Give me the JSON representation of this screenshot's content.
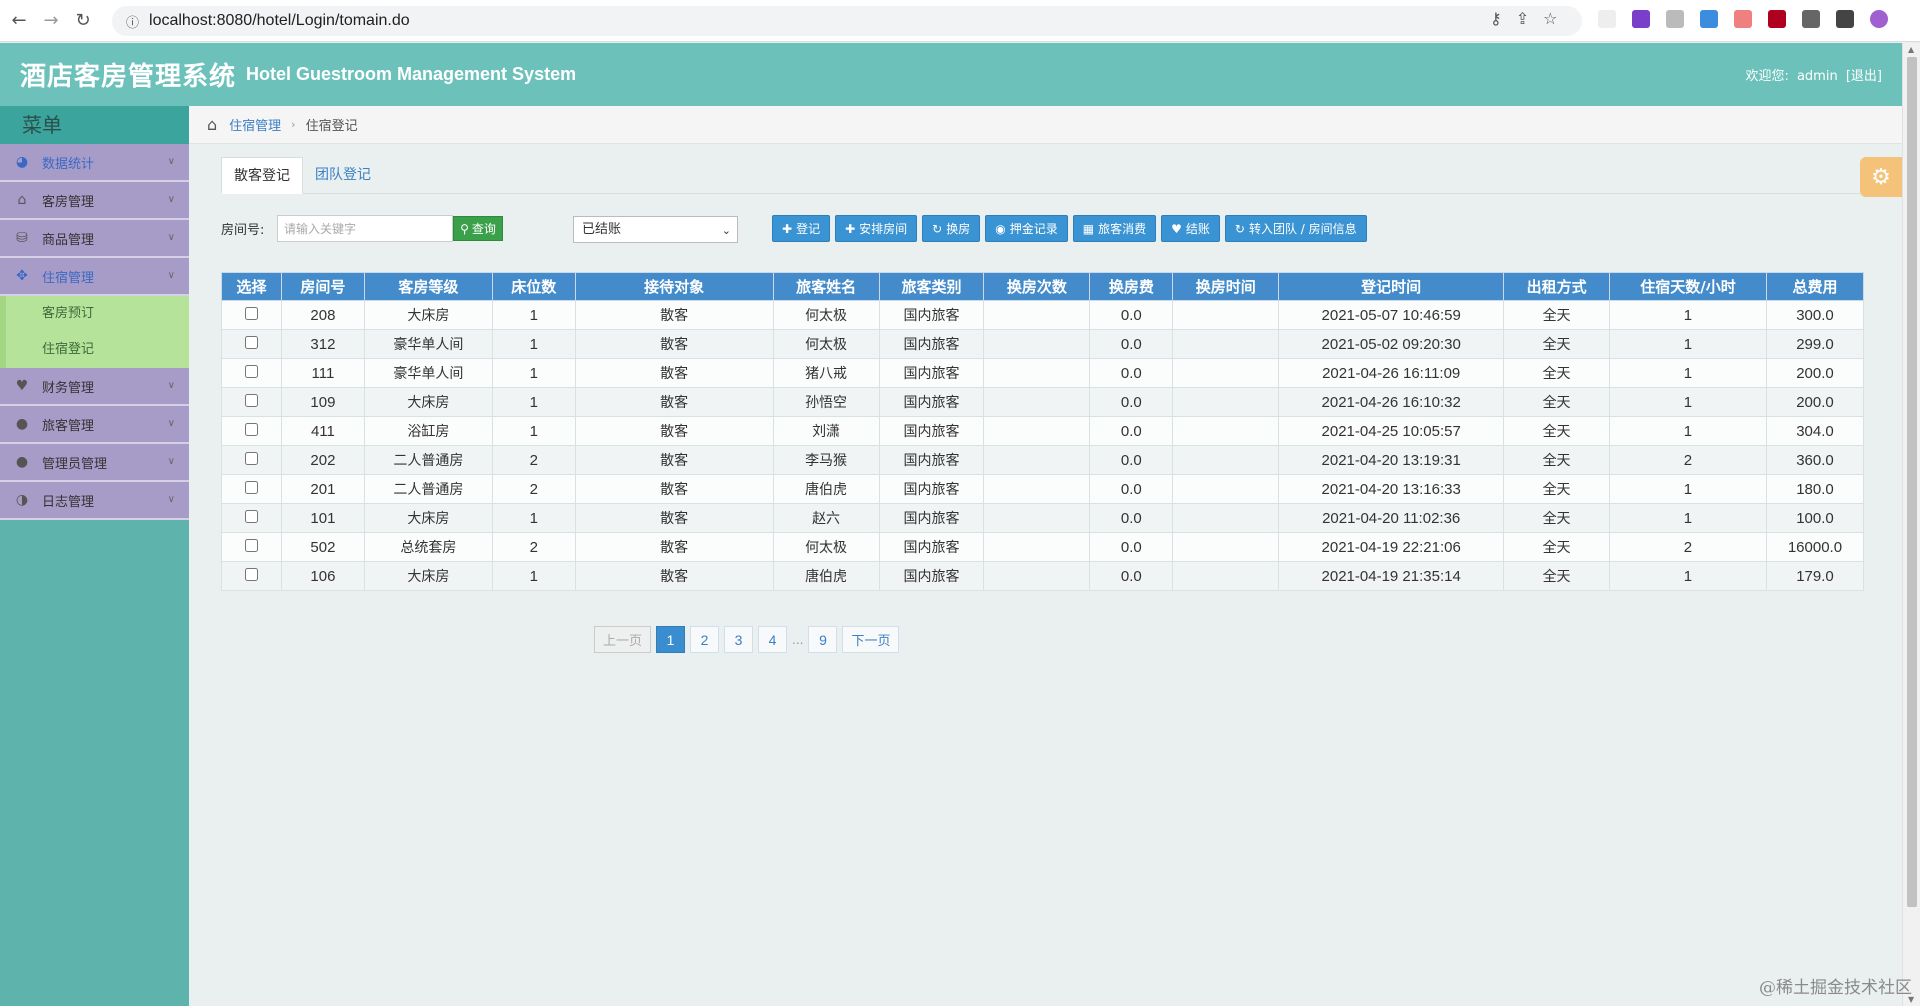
{
  "browser": {
    "url": "localhost:8080/hotel/Login/tomain.do"
  },
  "header": {
    "title": "酒店客房管理系统",
    "subtitle": "Hotel Guestroom Management System",
    "welcome_label": "欢迎您:",
    "username": "admin",
    "logout_label": "[退出]"
  },
  "sidebar": {
    "menu_title": "菜单",
    "items": [
      {
        "label": "数据统计",
        "icon": "dashboard-icon"
      },
      {
        "label": "客房管理",
        "icon": "home-icon"
      },
      {
        "label": "商品管理",
        "icon": "database-icon"
      },
      {
        "label": "住宿管理",
        "icon": "move-icon"
      },
      {
        "label": "财务管理",
        "icon": "heart-icon"
      },
      {
        "label": "旅客管理",
        "icon": "user-icon"
      },
      {
        "label": "管理员管理",
        "icon": "user-icon"
      },
      {
        "label": "日志管理",
        "icon": "contrast-icon"
      }
    ],
    "subitems": [
      {
        "label": "客房预订"
      },
      {
        "label": "住宿登记"
      }
    ]
  },
  "breadcrumb": {
    "parent": "住宿管理",
    "current": "住宿登记"
  },
  "tabs": [
    {
      "label": "散客登记",
      "active": true
    },
    {
      "label": "团队登记",
      "active": false
    }
  ],
  "toolbar": {
    "room_label": "房间号:",
    "search_placeholder": "请输入关键字",
    "search_button": "查询",
    "status_selected": "已结账",
    "actions": [
      {
        "label": "登记",
        "icon": "plus-icon"
      },
      {
        "label": "安排房间",
        "icon": "plus-icon"
      },
      {
        "label": "换房",
        "icon": "refresh-icon"
      },
      {
        "label": "押金记录",
        "icon": "eye-icon"
      },
      {
        "label": "旅客消费",
        "icon": "grid-icon"
      },
      {
        "label": "结账",
        "icon": "heart-icon"
      },
      {
        "label": "转入团队 / 房间信息",
        "icon": "refresh-icon"
      }
    ]
  },
  "table": {
    "headers": [
      "选择",
      "房间号",
      "客房等级",
      "床位数",
      "接待对象",
      "旅客姓名",
      "旅客类别",
      "换房次数",
      "换房费",
      "换房时间",
      "登记时间",
      "出租方式",
      "住宿天数/小时",
      "总费用"
    ],
    "rows": [
      [
        "208",
        "大床房",
        "1",
        "散客",
        "何太极",
        "国内旅客",
        "",
        "0.0",
        "",
        "2021-05-07 10:46:59",
        "全天",
        "1",
        "300.0"
      ],
      [
        "312",
        "豪华单人间",
        "1",
        "散客",
        "何太极",
        "国内旅客",
        "",
        "0.0",
        "",
        "2021-05-02 09:20:30",
        "全天",
        "1",
        "299.0"
      ],
      [
        "111",
        "豪华单人间",
        "1",
        "散客",
        "猪八戒",
        "国内旅客",
        "",
        "0.0",
        "",
        "2021-04-26 16:11:09",
        "全天",
        "1",
        "200.0"
      ],
      [
        "109",
        "大床房",
        "1",
        "散客",
        "孙悟空",
        "国内旅客",
        "",
        "0.0",
        "",
        "2021-04-26 16:10:32",
        "全天",
        "1",
        "200.0"
      ],
      [
        "411",
        "浴缸房",
        "1",
        "散客",
        "刘潇",
        "国内旅客",
        "",
        "0.0",
        "",
        "2021-04-25 10:05:57",
        "全天",
        "1",
        "304.0"
      ],
      [
        "202",
        "二人普通房",
        "2",
        "散客",
        "李马猴",
        "国内旅客",
        "",
        "0.0",
        "",
        "2021-04-20 13:19:31",
        "全天",
        "2",
        "360.0"
      ],
      [
        "201",
        "二人普通房",
        "2",
        "散客",
        "唐伯虎",
        "国内旅客",
        "",
        "0.0",
        "",
        "2021-04-20 13:16:33",
        "全天",
        "1",
        "180.0"
      ],
      [
        "101",
        "大床房",
        "1",
        "散客",
        "赵六",
        "国内旅客",
        "",
        "0.0",
        "",
        "2021-04-20 11:02:36",
        "全天",
        "1",
        "100.0"
      ],
      [
        "502",
        "总统套房",
        "2",
        "散客",
        "何太极",
        "国内旅客",
        "",
        "0.0",
        "",
        "2021-04-19 22:21:06",
        "全天",
        "2",
        "16000.0"
      ],
      [
        "106",
        "大床房",
        "1",
        "散客",
        "唐伯虎",
        "国内旅客",
        "",
        "0.0",
        "",
        "2021-04-19 21:35:14",
        "全天",
        "1",
        "179.0"
      ]
    ]
  },
  "pagination": {
    "prev": "上一页",
    "pages": [
      "1",
      "2",
      "3",
      "4"
    ],
    "ellipsis": "...",
    "last": "9",
    "next": "下一页",
    "current": "1"
  },
  "watermark": "@稀土掘金技术社区"
}
